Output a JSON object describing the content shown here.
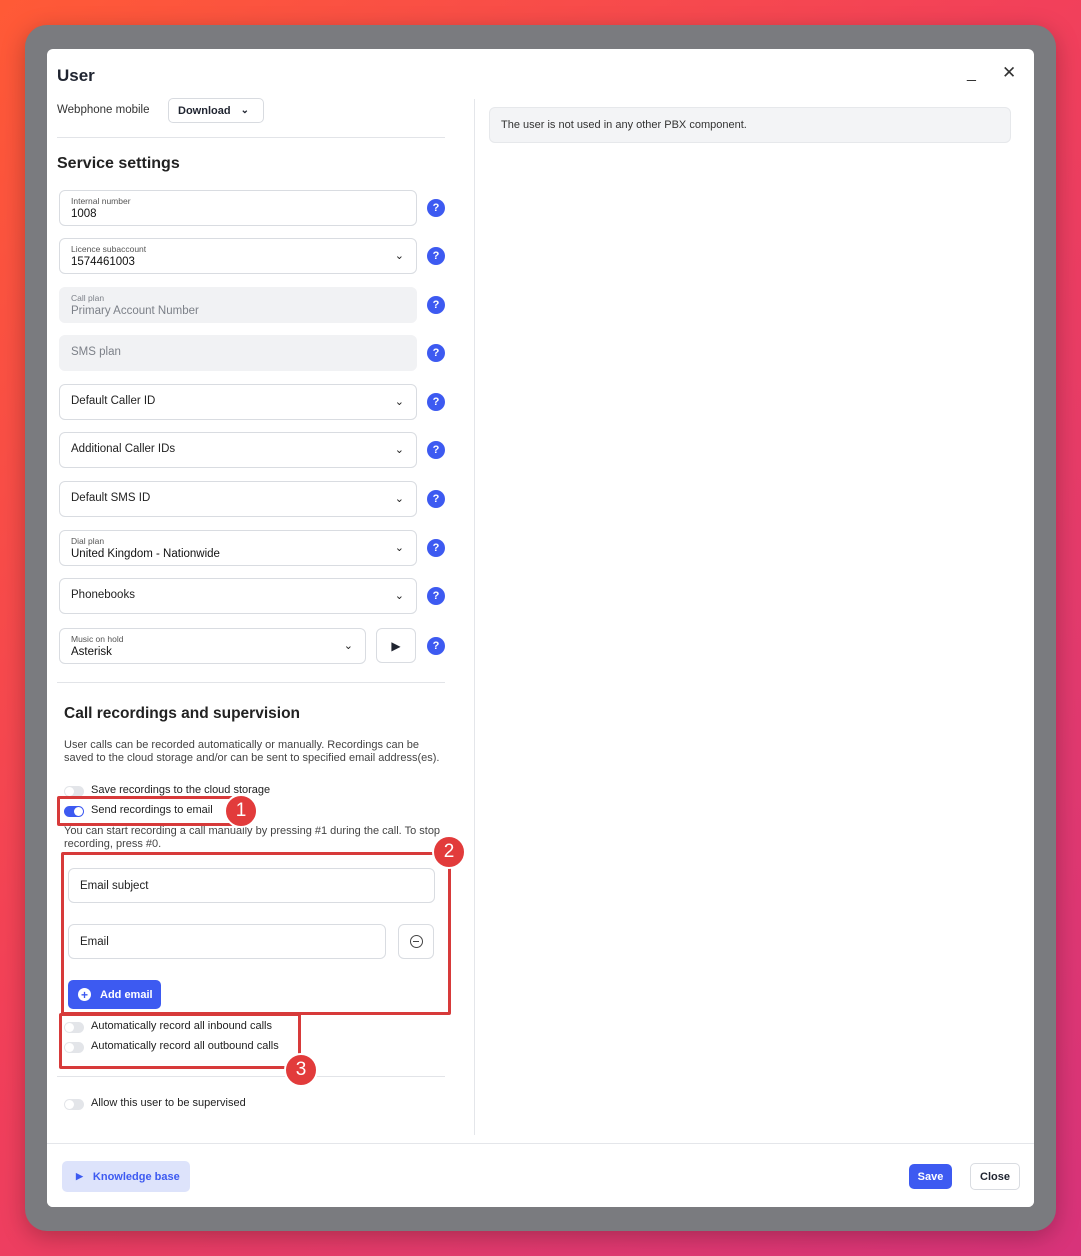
{
  "dialog": {
    "title": "User",
    "minimize_icon": "_",
    "close_icon": "✕"
  },
  "webphone": {
    "label": "Webphone mobile",
    "button_label": "Download"
  },
  "service_settings": {
    "title": "Service settings",
    "fields": {
      "internal_number": {
        "label": "Internal number",
        "value": "1008"
      },
      "licence_subaccount": {
        "label": "Licence subaccount",
        "value": "1574461003"
      },
      "call_plan": {
        "label": "Call plan",
        "value": "Primary Account Number"
      },
      "sms_plan": {
        "placeholder": "SMS plan"
      },
      "default_caller_id": {
        "placeholder": "Default Caller ID"
      },
      "additional_caller_ids": {
        "placeholder": "Additional Caller IDs"
      },
      "default_sms_id": {
        "placeholder": "Default SMS ID"
      },
      "dial_plan": {
        "label": "Dial plan",
        "value": "United Kingdom - Nationwide"
      },
      "phonebooks": {
        "placeholder": "Phonebooks"
      },
      "music_on_hold": {
        "label": "Music on hold",
        "value": "Asterisk"
      }
    },
    "help_icon": "?"
  },
  "recordings": {
    "title": "Call recordings and supervision",
    "description": "User calls can be recorded automatically or manually. Recordings can be saved to the cloud storage and/or can be sent to specified email address(es).",
    "save_cloud_label": "Save recordings to the cloud storage",
    "send_email_label": "Send recordings to email",
    "manual_note": "You can start recording a call manually by pressing #1 during the call. To stop recording, press #0.",
    "email_subject_placeholder": "Email subject",
    "email_placeholder": "Email",
    "add_email_label": "Add email",
    "auto_inbound_label": "Automatically record all inbound calls",
    "auto_outbound_label": "Automatically record all outbound calls",
    "supervise_label": "Allow this user to be supervised",
    "toggles": {
      "save_cloud": false,
      "send_email": true,
      "auto_inbound": false,
      "auto_outbound": false,
      "supervise": false
    }
  },
  "annotations": [
    "1",
    "2",
    "3"
  ],
  "info": {
    "message": "The user is not used in any other PBX component."
  },
  "footer": {
    "knowledge_base_label": "Knowledge base",
    "save_label": "Save",
    "close_label": "Close"
  },
  "colors": {
    "accent": "#3d5af1",
    "highlight": "#d73a3a"
  }
}
